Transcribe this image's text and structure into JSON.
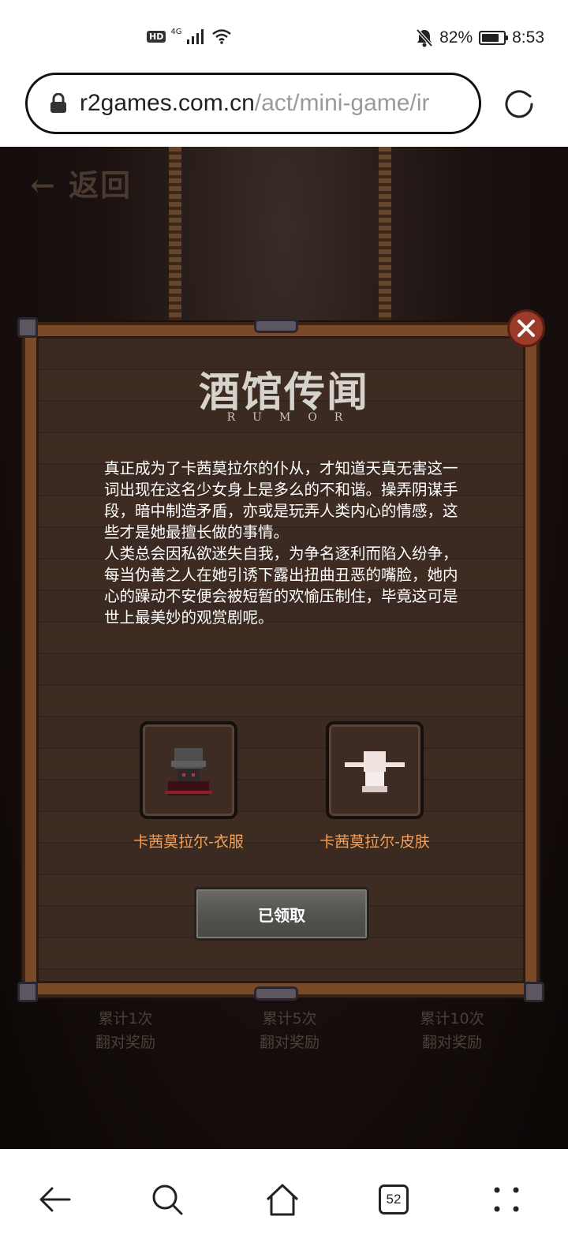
{
  "status_bar": {
    "hd": "HD",
    "network": "4G",
    "battery": "82%",
    "battery_level": 0.82,
    "time": "8:53"
  },
  "browser": {
    "url_domain": "r2games.com.cn",
    "url_path": "/act/mini-game/ir",
    "tab_count": "52"
  },
  "page": {
    "back_label": "← 返回",
    "counters": [
      {
        "line1": "累计1次",
        "line2": "翻对奖励"
      },
      {
        "line1": "累计5次",
        "line2": "翻对奖励"
      },
      {
        "line1": "累计10次",
        "line2": "翻对奖励"
      }
    ]
  },
  "modal": {
    "title": "酒馆传闻",
    "subtitle": "RUMOR",
    "paragraph1": "真正成为了卡茜莫拉尔的仆从，才知道天真无害这一词出现在这名少女身上是多么的不和谐。操弄阴谋手段，暗中制造矛盾，亦或是玩弄人类内心的情感，这些才是她最擅长做的事情。",
    "paragraph2": "人类总会因私欲迷失自我，为争名逐利而陷入纷争，每当伪善之人在她引诱下露出扭曲丑恶的嘴脸，她内心的躁动不安便会被短暂的欢愉压制住，毕竟这可是世上最美妙的观赏剧呢。",
    "rewards": [
      {
        "label": "卡茜莫拉尔-衣服",
        "icon": "outfit-icon"
      },
      {
        "label": "卡茜莫拉尔-皮肤",
        "icon": "skin-icon"
      }
    ],
    "button_label": "已领取"
  },
  "colors": {
    "accent_orange": "#f2a25a",
    "close_red": "#9b3b2a",
    "wood": "#7a4a28"
  }
}
